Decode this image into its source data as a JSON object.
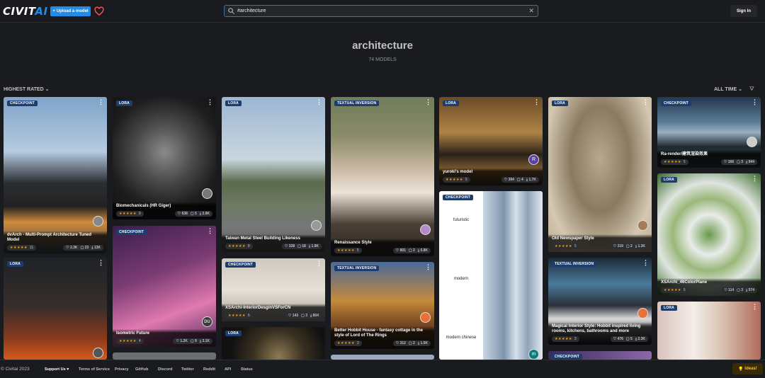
{
  "header": {
    "logo_main": "CIVIT",
    "logo_accent": "AI",
    "upload_label": "Upload a model",
    "search_value": "#architecture",
    "clear_glyph": "✕",
    "signin_label": "Sign In"
  },
  "hero": {
    "title": "architecture",
    "count": "74 MODELS"
  },
  "toolbar": {
    "sort_label": "HIGHEST RATED",
    "period_label": "ALL TIME"
  },
  "cards": {
    "c1": {
      "type": "CHECKPOINT",
      "name": "dvArch - Multi-Prompt Architecture Tuned Model",
      "stars": "★★★★★",
      "rating": "11",
      "likes": "2.3K",
      "comments": "23",
      "downloads": "13K"
    },
    "c2": {
      "type": "LORA"
    },
    "c3": {
      "type": "LORA",
      "name": "Biomechanicals (HR Giger)",
      "stars": "★★★★★",
      "rating": "9",
      "likes": "638",
      "comments": "5",
      "downloads": "2.9K"
    },
    "c4": {
      "type": "CHECKPOINT",
      "name": "Isometric Future",
      "stars": "★★★★★",
      "rating": "4",
      "likes": "1.2K",
      "comments": "9",
      "downloads": "3.1K",
      "avatar": "DU"
    },
    "c5": {
      "type": "LORA",
      "name": "Taiwan Metal Steel Building Likeness",
      "stars": "★★★★★",
      "rating": "8",
      "likes": "328",
      "comments": "18",
      "downloads": "1.9K"
    },
    "c6": {
      "type": "CHECKPOINT",
      "name": "XSArchi-InteriorDesginVSForCN",
      "stars": "★★★★★",
      "rating": "6",
      "likes": "143",
      "comments": "3",
      "downloads": "804"
    },
    "c7": {
      "type": "LORA"
    },
    "c8": {
      "type": "TEXTUAL INVERSION",
      "name": "Renaissance Style",
      "stars": "★★★★★",
      "rating": "5",
      "likes": "801",
      "comments": "2",
      "downloads": "5.8K"
    },
    "c9": {
      "type": "TEXTUAL INVERSION",
      "name": "Better Hobbit House - fantasy cottage in the style of Lord of The Rings",
      "stars": "★★★★★",
      "rating": "3",
      "likes": "312",
      "comments": "2",
      "downloads": "1.5K"
    },
    "c10": {
      "type": "LORA",
      "name": "yuroki's model",
      "stars": "★★★★★",
      "rating": "5",
      "likes": "394",
      "comments": "4",
      "downloads": "1.7K",
      "avatar": "R"
    },
    "c11": {
      "type": "CHECKPOINT",
      "labels": [
        "futuristic",
        "modern",
        "modern chinese"
      ],
      "avatar": "m"
    },
    "c12": {
      "type": "LORA",
      "name": "Old Newspaper Style",
      "stars": "★★★★★",
      "rating": "5",
      "likes": "219",
      "comments": "2",
      "downloads": "1.3K"
    },
    "c13": {
      "type": "TEXTUAL INVERSION",
      "name": "Magical Interior Style: Hobbit inspired living rooms, kitchens, bathrooms and more",
      "stars": "★★★★★",
      "rating": "3",
      "likes": "476",
      "comments": "5",
      "downloads": "2.3K"
    },
    "c14": {
      "type": "CHECKPOINT"
    },
    "c15": {
      "type": "CHECKPOINT",
      "name": "Ra-render/建筑渲染效果",
      "stars": "★★★★★",
      "rating": "5",
      "likes": "166",
      "comments": "3",
      "downloads": "944"
    },
    "c16": {
      "type": "LORA",
      "name": "XSArchi_46ColorPlane",
      "stars": "★★★★★",
      "rating": "5",
      "likes": "114",
      "comments": "3",
      "downloads": "574"
    },
    "c17": {
      "type": "LORA"
    }
  },
  "footer": {
    "copyright": "© Civitai 2023",
    "links": [
      "Support Us ♥",
      "Terms of Service",
      "Privacy",
      "GitHub",
      "Discord",
      "Twitter",
      "Reddit",
      "API",
      "Status"
    ],
    "ideas_label": "Ideas!"
  },
  "icons": {
    "heart": "heart-icon",
    "search": "search-icon",
    "filter": "filter-icon",
    "likes": "heart-icon",
    "comments": "comment-icon",
    "downloads": "download-icon"
  },
  "colors": {
    "accent": "#228be6",
    "background": "#1a1b1e",
    "star": "#f59f00",
    "badge": "#1c3d6e"
  }
}
